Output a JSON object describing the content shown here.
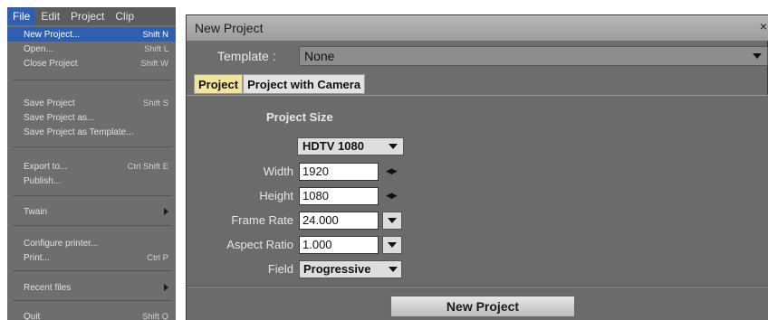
{
  "menubar": {
    "items": [
      "File",
      "Edit",
      "Project",
      "Clip"
    ]
  },
  "file_menu": {
    "items": [
      {
        "label": "New Project...",
        "shortcut": "Shift N",
        "highlighted": true
      },
      {
        "label": "Open...",
        "shortcut": "Shift L"
      },
      {
        "label": "Close Project",
        "shortcut": "Shift W"
      },
      {
        "label": "Save Project",
        "shortcut": "Shift S"
      },
      {
        "label": "Save Project as..."
      },
      {
        "label": "Save Project as Template..."
      },
      {
        "label": "Export to...",
        "shortcut": "Ctrl Shift E"
      },
      {
        "label": "Publish..."
      },
      {
        "label": "Twain",
        "submenu": true
      },
      {
        "label": "Configure printer..."
      },
      {
        "label": "Print...",
        "shortcut": "Ctrl P"
      },
      {
        "label": "Recent files",
        "submenu": true
      },
      {
        "label": "Quit",
        "shortcut": "Shift Q"
      }
    ]
  },
  "dialog": {
    "title": "New Project",
    "close_glyph": "×",
    "template_label": "Template :",
    "template_value": "None",
    "tabs": [
      "Project",
      "Project with Camera"
    ],
    "section_title": "Project Size",
    "size_preset": "HDTV 1080",
    "fields": {
      "width_label": "Width",
      "width_value": "1920",
      "height_label": "Height",
      "height_value": "1080",
      "frame_rate_label": "Frame Rate",
      "frame_rate_value": "24.000",
      "aspect_ratio_label": "Aspect Ratio",
      "aspect_ratio_value": "1.000",
      "field_label": "Field",
      "field_value": "Progressive"
    },
    "spin_glyph": "◀▶",
    "button_label": "New Project"
  },
  "colors": {
    "highlight": "#2f5fb0",
    "active_tab": "#f3e49a",
    "panel": "#6b6b6b"
  }
}
